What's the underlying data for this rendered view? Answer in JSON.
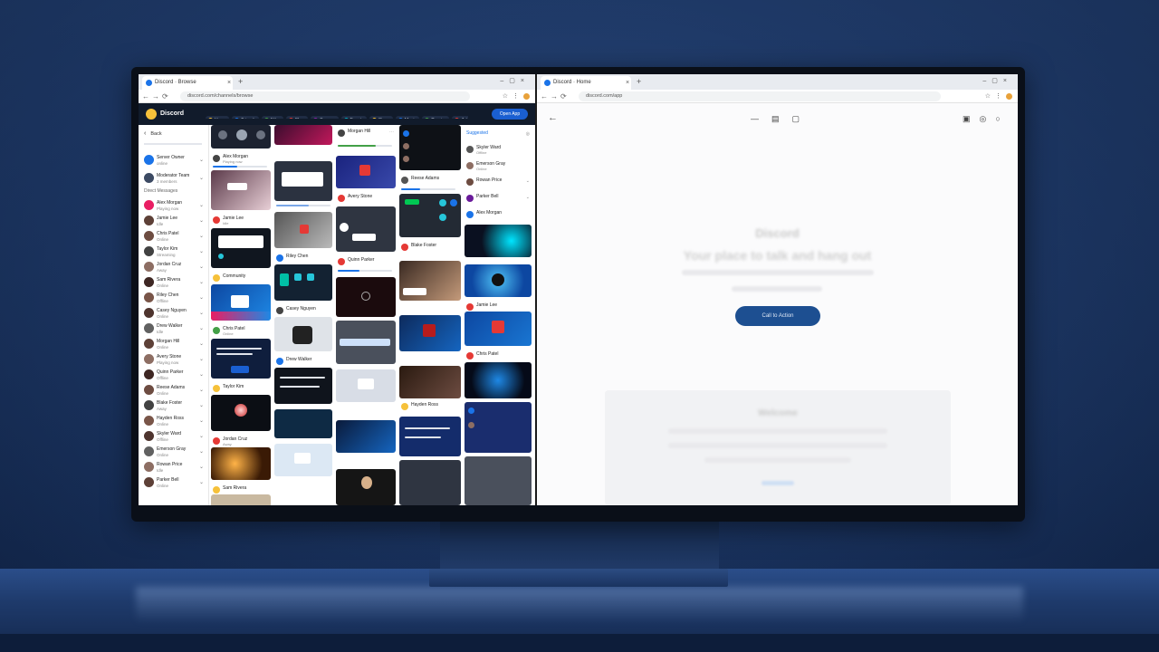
{
  "left_window": {
    "tab_title": "Discord · Browse",
    "url": "discord.com/channels/browse",
    "app": {
      "brand": "Discord",
      "nav_items": [
        "Home",
        "Friends",
        "Nitro",
        "Shop",
        "Servers",
        "Events",
        "Stage",
        "Music",
        "Gaming",
        "Art",
        "Learn"
      ],
      "cta_label": "Open App"
    },
    "sidebar": {
      "back_label": "Back",
      "section_label": "Direct Messages",
      "top_user": {
        "name": "Server Owner",
        "sub": "online"
      },
      "top_user2": {
        "name": "Moderator Team",
        "sub": "3 members"
      },
      "users": [
        {
          "name": "Alex Morgan",
          "sub": "Playing now"
        },
        {
          "name": "Jamie Lee",
          "sub": "Idle"
        },
        {
          "name": "Chris Patel",
          "sub": "Online"
        },
        {
          "name": "Taylor Kim",
          "sub": "Streaming"
        },
        {
          "name": "Jordan Cruz",
          "sub": "Away"
        },
        {
          "name": "Sam Rivera",
          "sub": "Online"
        },
        {
          "name": "Riley Chen",
          "sub": "Offline"
        },
        {
          "name": "Casey Nguyen",
          "sub": "Online"
        },
        {
          "name": "Drew Walker",
          "sub": "Idle"
        },
        {
          "name": "Morgan Hill",
          "sub": "Online"
        },
        {
          "name": "Avery Stone",
          "sub": "Playing now"
        },
        {
          "name": "Quinn Parker",
          "sub": "Offline"
        },
        {
          "name": "Reese Adams",
          "sub": "Online"
        },
        {
          "name": "Blake Foster",
          "sub": "Away"
        },
        {
          "name": "Hayden Ross",
          "sub": "Online"
        },
        {
          "name": "Skyler Ward",
          "sub": "Offline"
        },
        {
          "name": "Emerson Gray",
          "sub": "Online"
        },
        {
          "name": "Rowan Price",
          "sub": "Idle"
        },
        {
          "name": "Parker Bell",
          "sub": "Online"
        }
      ]
    },
    "feed_label": "Community",
    "list_label": "Suggested"
  },
  "right_window": {
    "tab_title": "Discord · Home",
    "url": "discord.com/app",
    "title": "Discord",
    "headline": "Your place to talk and hang out",
    "cta_label": "Call to Action",
    "panel_title": "Welcome"
  },
  "colors": {
    "accent": "#1a5fd1",
    "cta": "#1d4f91",
    "appbar": "#111b2b",
    "logo": "#f6c13a"
  }
}
